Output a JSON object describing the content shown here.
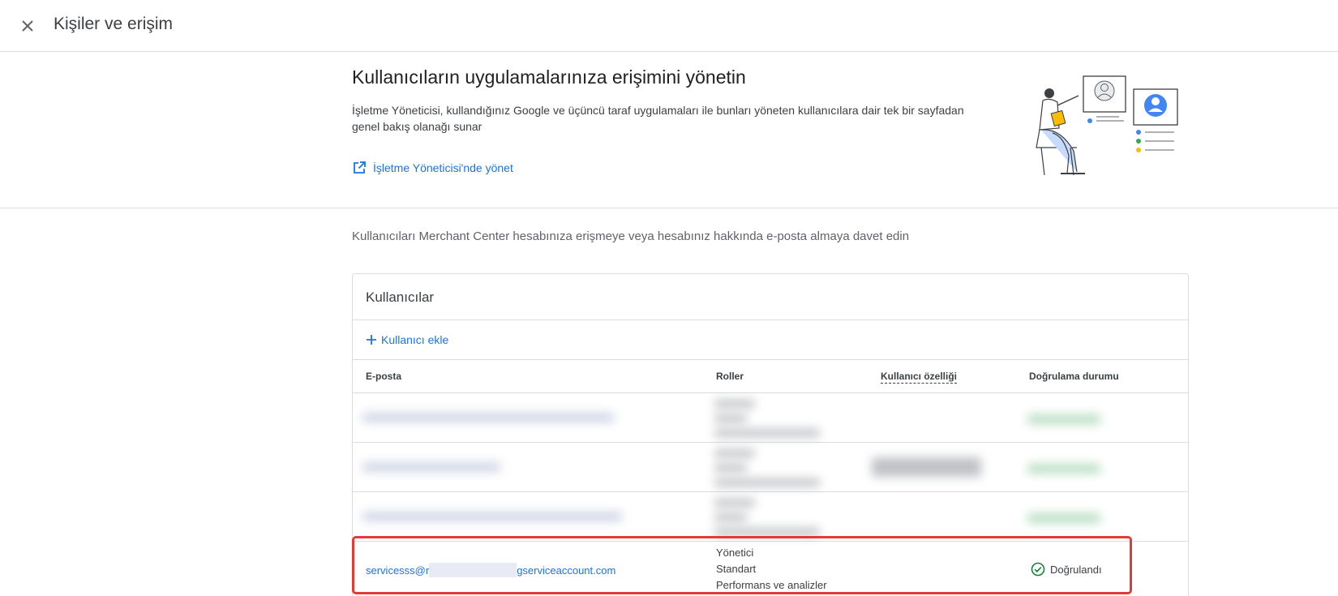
{
  "topbar": {
    "title": "Kişiler ve erişim",
    "close_icon": "close-icon"
  },
  "hero": {
    "title": "Kullanıcıların uygulamalarınıza erişimini yönetin",
    "description": "İşletme Yöneticisi, kullandığınız Google ve üçüncü taraf uygulamaları ile bunları yöneten kullanıcılara dair tek bir sayfadan genel bakış olanağı sunar",
    "link_label": "İşletme Yöneticisi'nde yönet",
    "link_icon": "open-in-new-icon"
  },
  "invite_text": "Kullanıcıları Merchant Center hesabınıza erişmeye veya hesabınız hakkında e-posta almaya davet edin",
  "users_card": {
    "title": "Kullanıcılar",
    "add_user_label": "Kullanıcı ekle",
    "columns": {
      "email": "E-posta",
      "roles": "Roller",
      "user_attribute": "Kullanıcı özelliği",
      "verification_status": "Doğrulama durumu"
    },
    "visible_user": {
      "email_prefix": "servicesss@r",
      "email_suffix": "gserviceaccount.com",
      "roles": [
        "Yönetici",
        "Standart",
        "Performans ve analizler"
      ],
      "status": "Doğrulandı"
    }
  },
  "colors": {
    "accent": "#1a73e8",
    "success": "#188038",
    "highlight": "#e53935",
    "divider": "#dadce0"
  }
}
